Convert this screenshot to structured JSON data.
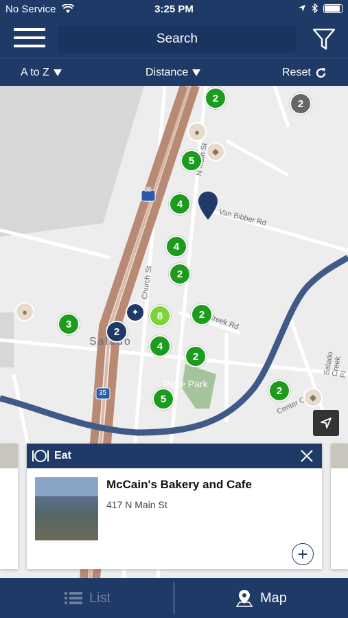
{
  "status": {
    "carrier": "No Service",
    "time": "3:25 PM"
  },
  "header": {
    "search_label": "Search"
  },
  "sort": {
    "az": "A to Z",
    "distance": "Distance",
    "reset": "Reset"
  },
  "map": {
    "clusters": [
      "2",
      "2",
      "5",
      "4",
      "4",
      "2",
      "8",
      "2",
      "2",
      "4",
      "2",
      "3",
      "5",
      "2"
    ],
    "labels": {
      "main_st": "N Main St",
      "van_bibber": "Van Bibber Rd",
      "church": "Church St",
      "salado": "Salado",
      "pace_park": "Pace Park",
      "creek_rd": "Creek Rd",
      "salado_creek": "Salado Creek Pl",
      "center": "Center C",
      "i35_top": "35",
      "i35_bottom": "35"
    }
  },
  "card": {
    "category": "Eat",
    "title": "McCain's Bakery and Cafe",
    "address": "417 N Main St"
  },
  "nav": {
    "list": "List",
    "map": "Map"
  },
  "colors": {
    "brand": "#1f3a66",
    "cluster_green": "#1c9b1c",
    "cluster_light": "#7fd33a"
  }
}
